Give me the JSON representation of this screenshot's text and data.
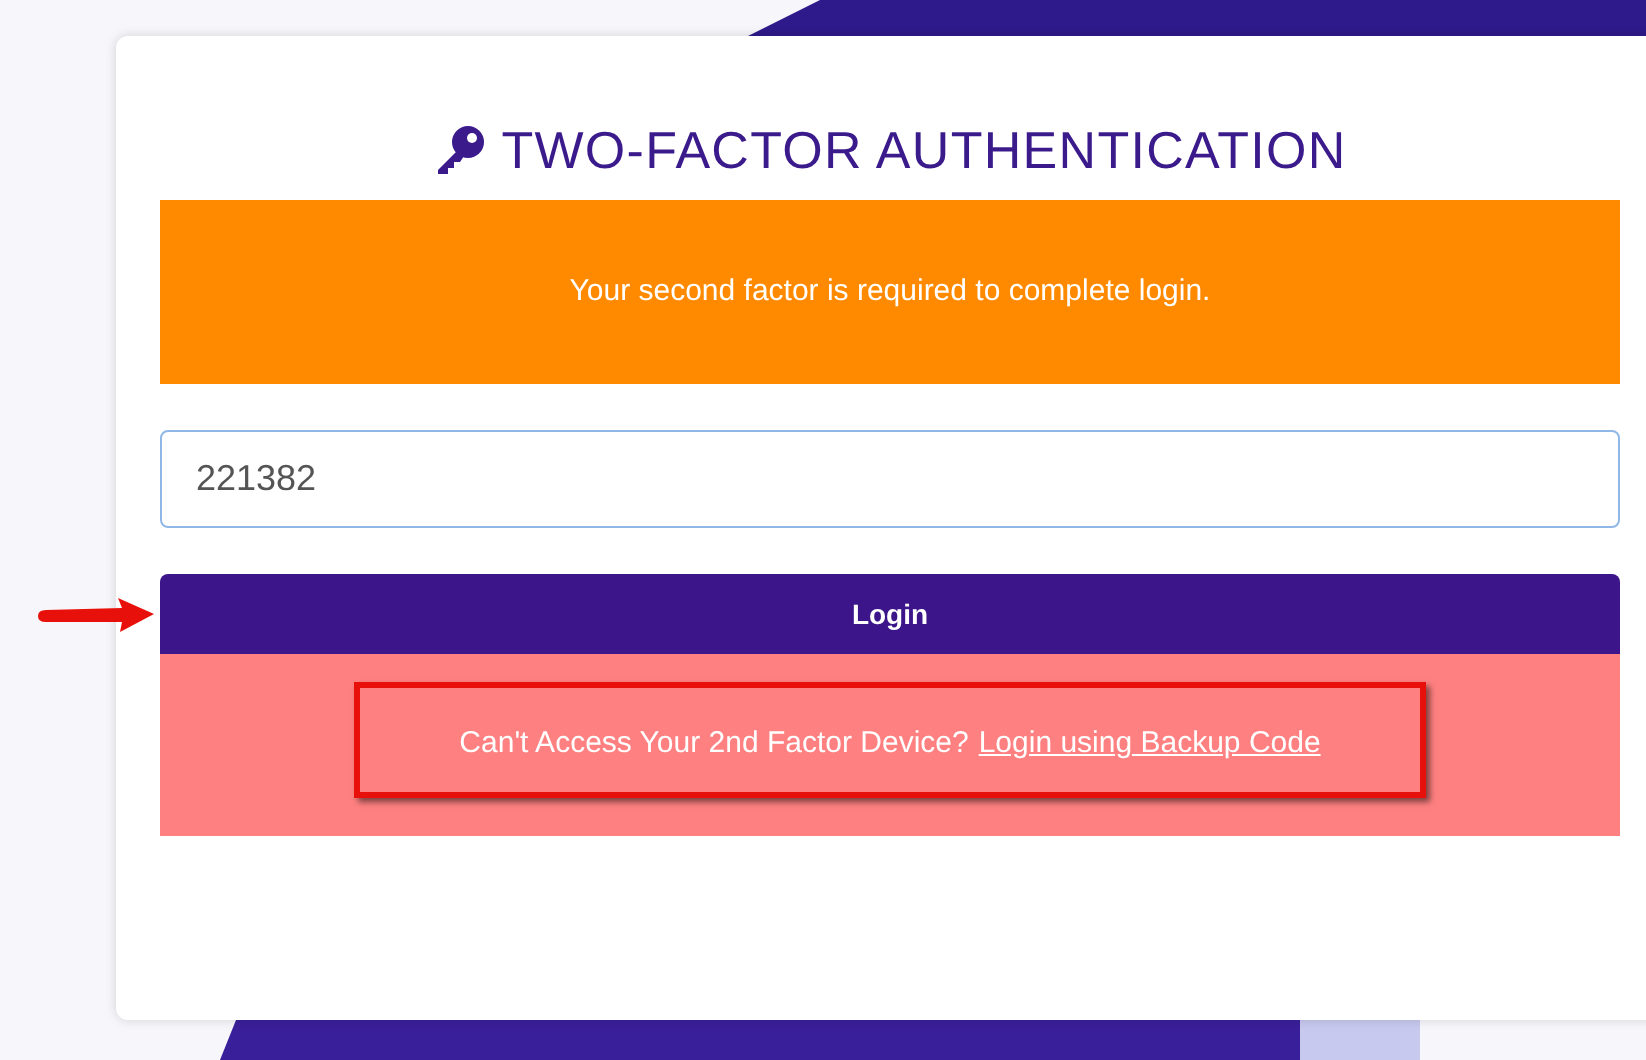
{
  "title": "TWO-FACTOR AUTHENTICATION",
  "notice": "Your second factor is required to complete login.",
  "code_field": {
    "value": "221382"
  },
  "login_button": "Login",
  "backup": {
    "text": "Can't Access Your 2nd Factor Device?",
    "link": "Login using Backup Code"
  }
}
